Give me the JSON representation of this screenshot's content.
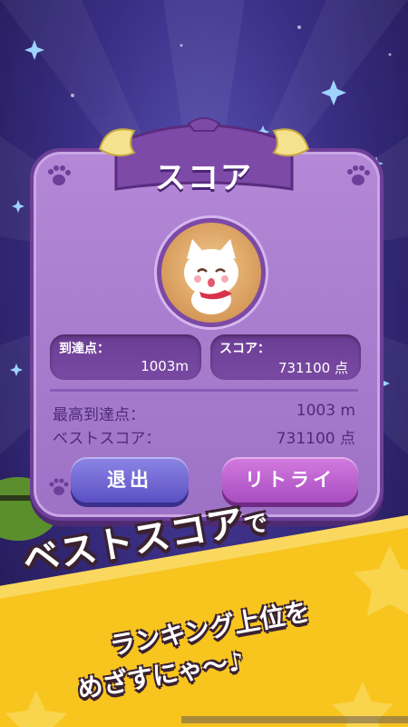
{
  "score_panel": {
    "title": "スコア",
    "reached_label": "到達点：",
    "reached_value": "1003m",
    "score_label": "スコア：",
    "score_value": "731100 点",
    "best_reached_label": "最高到達点：",
    "best_reached_value": "1003 m",
    "best_score_label": "ベストスコア：",
    "best_score_value": "731100 点",
    "exit_button": "退出",
    "retry_button": "リトライ"
  },
  "promo": {
    "headline": "ベストスコア",
    "headline_particle": "で",
    "line2": "ランキング上位を",
    "line3": "めざすにゃ〜♪"
  },
  "colors": {
    "background": "#3b2f86",
    "panel": "#a97cd0",
    "banner": "#f7c51e"
  },
  "icons": [
    "cat-avatar-icon",
    "paw-icon",
    "star-icon"
  ]
}
